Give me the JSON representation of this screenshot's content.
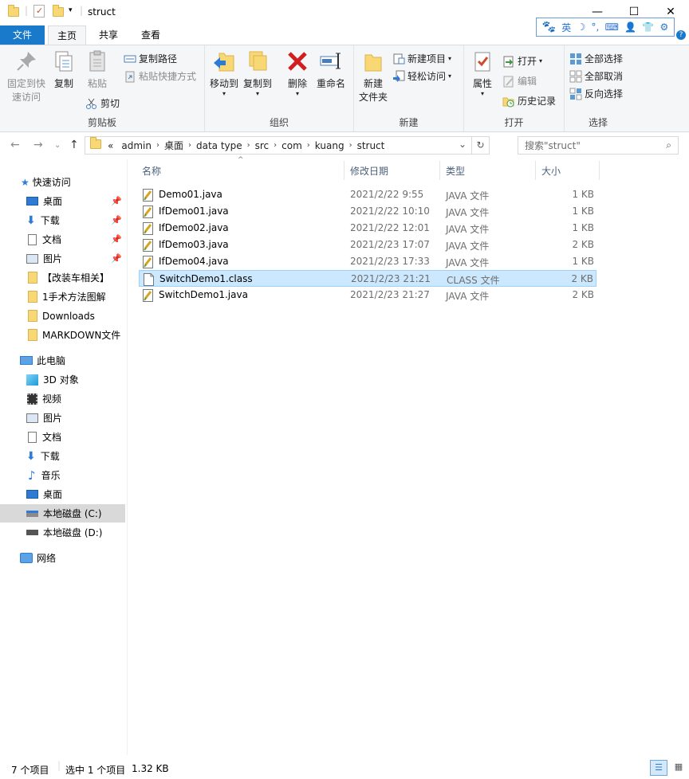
{
  "window": {
    "title": "struct"
  },
  "title_icons": [
    "folder-icon",
    "properties-check-icon",
    "new-folder-icon",
    "dropdown-arrow-icon"
  ],
  "ime": {
    "lang": "英"
  },
  "tabs": {
    "file": "文件",
    "home": "主页",
    "share": "共享",
    "view": "查看"
  },
  "ribbon": {
    "clipboard": {
      "label": "剪贴板",
      "pin_line1": "固定到快",
      "pin_line2": "速访问",
      "copy": "复制",
      "paste": "粘贴",
      "copy_path": "复制路径",
      "paste_shortcut": "粘贴快捷方式",
      "cut": "剪切"
    },
    "organize": {
      "label": "组织",
      "move_to": "移动到",
      "copy_to": "复制到",
      "delete": "删除",
      "rename": "重命名"
    },
    "new": {
      "label": "新建",
      "new_folder_line1": "新建",
      "new_folder_line2": "文件夹",
      "new_item": "新建项目",
      "easy_access": "轻松访问"
    },
    "open": {
      "label": "打开",
      "properties": "属性",
      "open": "打开",
      "edit": "编辑",
      "history": "历史记录"
    },
    "select": {
      "label": "选择",
      "select_all": "全部选择",
      "select_none": "全部取消",
      "invert": "反向选择"
    }
  },
  "address": {
    "overflow": "«",
    "crumbs": [
      "admin",
      "桌面",
      "data type",
      "src",
      "com",
      "kuang",
      "struct"
    ]
  },
  "search": {
    "placeholder": "搜索\"struct\""
  },
  "nav": {
    "quick_access": "快速访问",
    "qa_items": [
      "桌面",
      "下载",
      "文档",
      "图片",
      "【改装车相关】",
      "1手术方法图解",
      "Downloads",
      "MARKDOWN文件"
    ],
    "this_pc": "此电脑",
    "pc_items": [
      "3D 对象",
      "视频",
      "图片",
      "文档",
      "下载",
      "音乐",
      "桌面",
      "本地磁盘 (C:)",
      "本地磁盘 (D:)"
    ],
    "network": "网络"
  },
  "columns": {
    "name": "名称",
    "date": "修改日期",
    "type": "类型",
    "size": "大小"
  },
  "files": [
    {
      "name": "Demo01.java",
      "date": "2021/2/22 9:55",
      "type": "JAVA 文件",
      "size": "1 KB",
      "icon": "java-file-icon"
    },
    {
      "name": "IfDemo01.java",
      "date": "2021/2/22 10:10",
      "type": "JAVA 文件",
      "size": "1 KB",
      "icon": "java-file-icon"
    },
    {
      "name": "IfDemo02.java",
      "date": "2021/2/22 12:01",
      "type": "JAVA 文件",
      "size": "1 KB",
      "icon": "java-file-icon"
    },
    {
      "name": "IfDemo03.java",
      "date": "2021/2/23 17:07",
      "type": "JAVA 文件",
      "size": "2 KB",
      "icon": "java-file-icon"
    },
    {
      "name": "IfDemo04.java",
      "date": "2021/2/23 17:33",
      "type": "JAVA 文件",
      "size": "1 KB",
      "icon": "java-file-icon"
    },
    {
      "name": "SwitchDemo1.class",
      "date": "2021/2/23 21:21",
      "type": "CLASS 文件",
      "size": "2 KB",
      "icon": "class-file-icon"
    },
    {
      "name": "SwitchDemo1.java",
      "date": "2021/2/23 21:27",
      "type": "JAVA 文件",
      "size": "2 KB",
      "icon": "java-file-icon"
    }
  ],
  "status": {
    "count": "7 个项目",
    "selected": "选中 1 个项目",
    "size": "1.32 KB"
  },
  "colors": {
    "accent": "#1979ca",
    "selection": "#cce8ff",
    "selection_border": "#99d1ff"
  }
}
